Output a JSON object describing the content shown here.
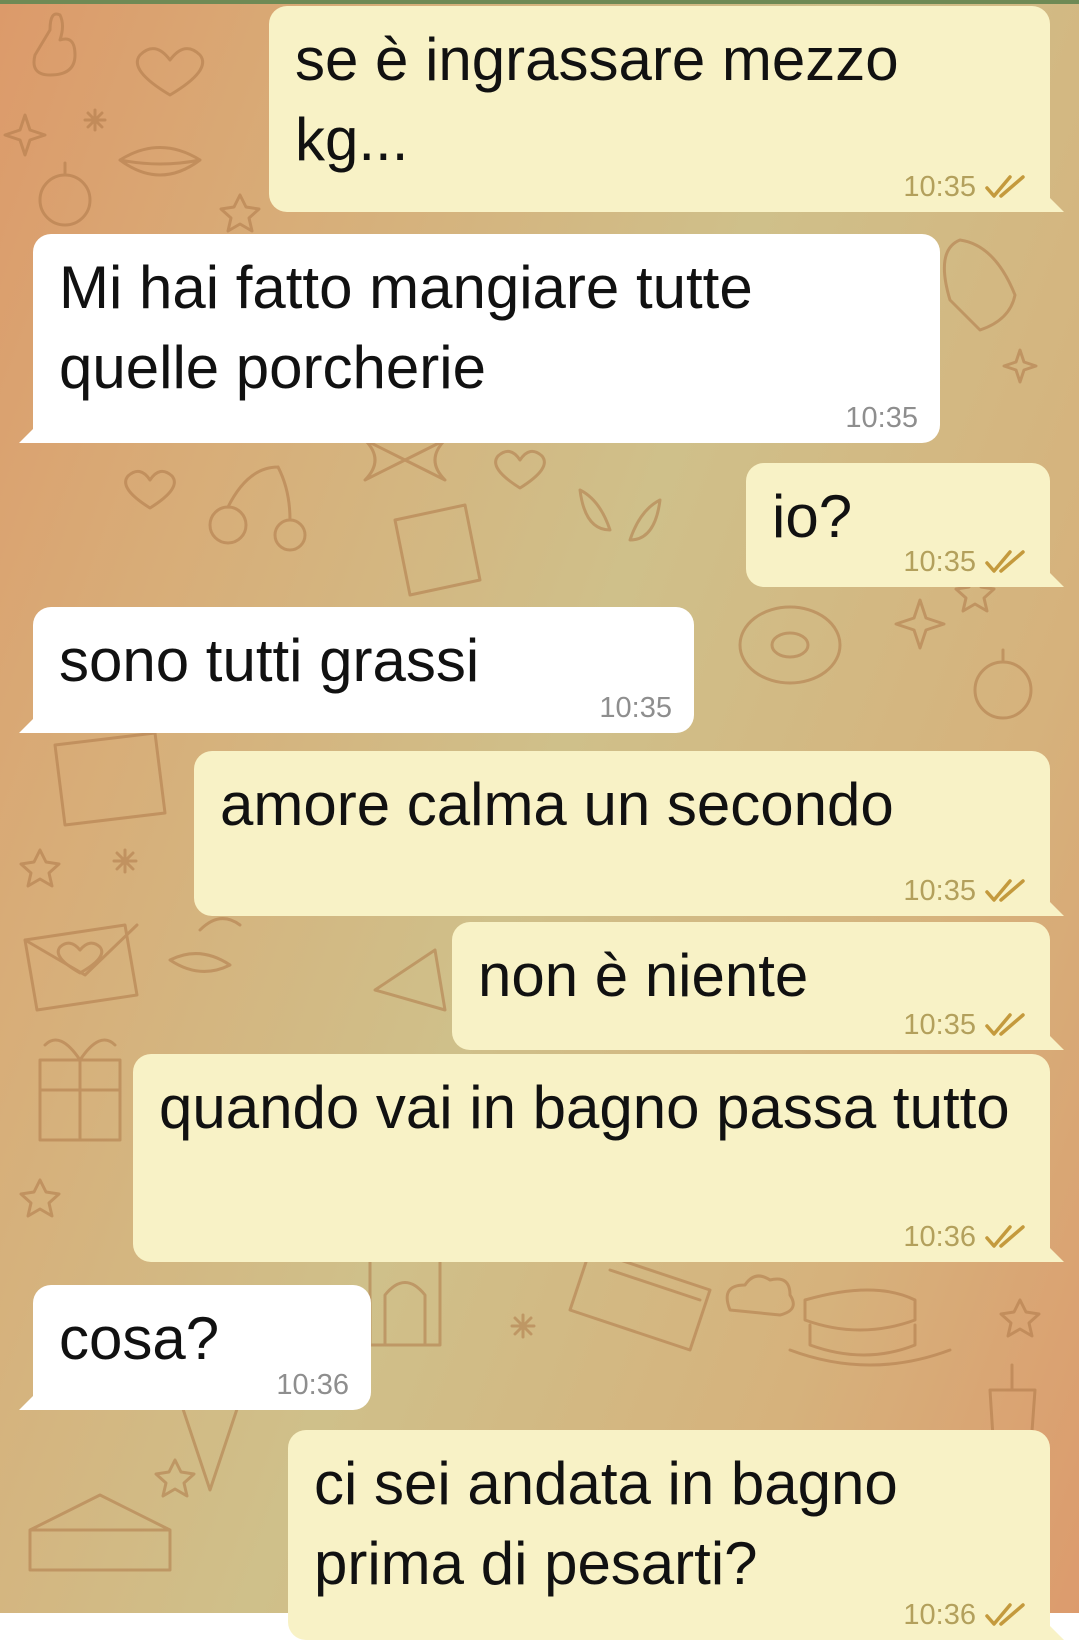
{
  "theme": {
    "incoming_bubble": "#ffffff",
    "outgoing_bubble": "#f8f2c6",
    "read_check_color": "#c49a3d",
    "background_gradient": [
      "#dc9a6a",
      "#cfc08a",
      "#dc9b6d"
    ]
  },
  "messages": [
    {
      "direction": "outgoing",
      "text": "se è ingrassare mezzo kg...",
      "time": "10:35",
      "status": "read"
    },
    {
      "direction": "incoming",
      "text": "Mi hai fatto mangiare tutte quelle porcherie",
      "time": "10:35"
    },
    {
      "direction": "outgoing",
      "text": "io?",
      "time": "10:35",
      "status": "read"
    },
    {
      "direction": "incoming",
      "text": "sono tutti grassi",
      "time": "10:35"
    },
    {
      "direction": "outgoing",
      "text": "amore calma un secondo",
      "time": "10:35",
      "status": "read"
    },
    {
      "direction": "outgoing",
      "text": "non è niente",
      "time": "10:35",
      "status": "read"
    },
    {
      "direction": "outgoing",
      "text": "quando vai in bagno passa tutto",
      "time": "10:36",
      "status": "read"
    },
    {
      "direction": "incoming",
      "text": "cosa?",
      "time": "10:36"
    },
    {
      "direction": "outgoing",
      "text": "ci sei andata in bagno prima di pesarti?",
      "time": "10:36",
      "status": "read"
    }
  ]
}
